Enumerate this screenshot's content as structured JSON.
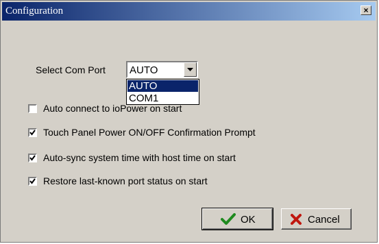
{
  "window": {
    "title": "Configuration",
    "close_label": "×"
  },
  "com_port": {
    "label": "Select Com Port",
    "selected": "AUTO",
    "options": [
      "AUTO",
      "COM1"
    ]
  },
  "checkboxes": [
    {
      "label": "Auto connect to ioPower on start",
      "checked": false
    },
    {
      "label": "Touch Panel Power ON/OFF Confirmation Prompt",
      "checked": true
    },
    {
      "label": "Auto-sync system time with host time on start",
      "checked": true
    },
    {
      "label": "Restore last-known port status on start",
      "checked": true
    }
  ],
  "buttons": {
    "ok_label": "OK",
    "cancel_label": "Cancel"
  },
  "colors": {
    "ok_check": "#1f8a1f",
    "cancel_x": "#c0170f",
    "selection": "#0a246a"
  }
}
